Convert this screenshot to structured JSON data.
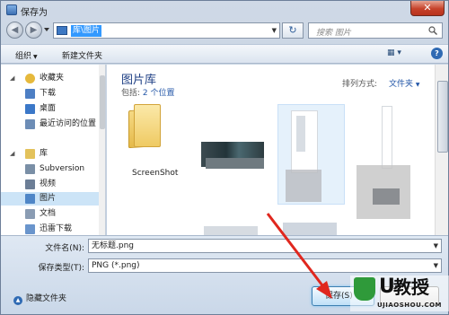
{
  "window": {
    "title": "保存为",
    "close_label": "✕"
  },
  "nav": {
    "back_glyph": "◀",
    "forward_glyph": "▶",
    "address": "库\\图片",
    "refresh_glyph": "↻",
    "search_placeholder": "搜索 图片"
  },
  "toolbar": {
    "organize": "组织",
    "new_folder": "新建文件夹",
    "help": "?"
  },
  "sidebar": {
    "items": [
      {
        "label": "收藏夹",
        "icon": "star-icon",
        "color": "#e6b93c"
      },
      {
        "label": "下载",
        "icon": "download-folder-icon",
        "color": "#4d7fc4"
      },
      {
        "label": "桌面",
        "icon": "desktop-icon",
        "color": "#3b78c8"
      },
      {
        "label": "最近访问的位置",
        "icon": "recent-places-icon",
        "color": "#6d8db6"
      },
      {
        "label": "库",
        "icon": "library-icon",
        "color": "#e3c25b"
      },
      {
        "label": "Subversion",
        "icon": "subversion-folder-icon",
        "color": "#7a8fa6"
      },
      {
        "label": "视频",
        "icon": "videos-icon",
        "color": "#6c7e96"
      },
      {
        "label": "图片",
        "icon": "pictures-icon",
        "color": "#4f86c7"
      },
      {
        "label": "文档",
        "icon": "documents-icon",
        "color": "#8a9cb3"
      },
      {
        "label": "迅雷下载",
        "icon": "thunder-download-icon",
        "color": "#6a95cc"
      }
    ]
  },
  "library": {
    "title": "图片库",
    "includes_prefix": "包括:",
    "includes_link": "2 个位置",
    "arrange_label": "排列方式:",
    "arrange_value": "文件夹",
    "folder_name": "ScreenShot"
  },
  "form": {
    "filename_label": "文件名(N):",
    "filename_value": "无标题.png",
    "filetype_label": "保存类型(T):",
    "filetype_value": "PNG (*.png)",
    "hide_folders": "隐藏文件夹",
    "save_button": "保存(S)"
  },
  "watermark": {
    "letter": "U",
    "text": "教授",
    "sub": "UJIAOSHOU.COM"
  },
  "colors": {
    "accent": "#3399ff",
    "library_title": "#1e3f84",
    "arrow": "#e0271e"
  }
}
